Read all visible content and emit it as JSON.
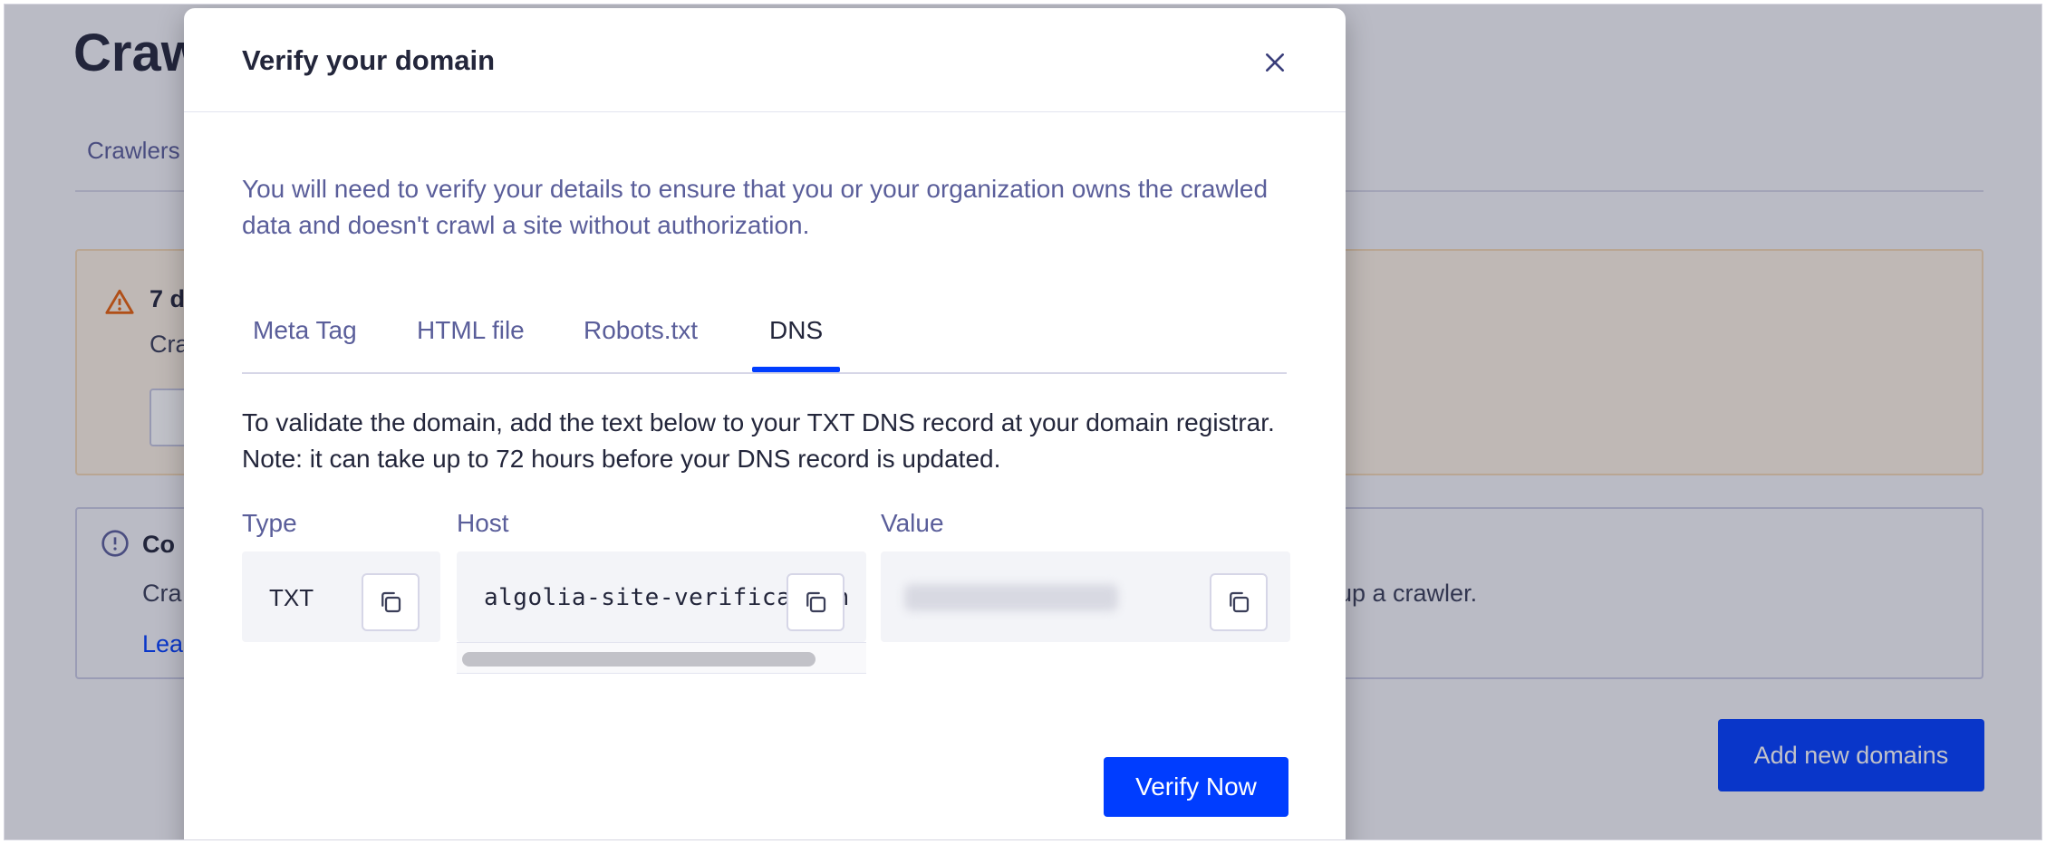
{
  "background": {
    "page_title": "Craw",
    "tab_label": "Crawlers",
    "warning": {
      "title": "7 d",
      "text": "Cra"
    },
    "info": {
      "title": "Co",
      "text": "Cra",
      "text_right": "up a crawler.",
      "link": "Lea"
    },
    "add_domains_label": "Add new domains"
  },
  "modal": {
    "title": "Verify your domain",
    "intro": "You will need to verify your details to ensure that you or your organization owns the crawled data and doesn't crawl a site without authorization.",
    "tabs": [
      "Meta Tag",
      "HTML file",
      "Robots.txt",
      "DNS"
    ],
    "active_tab": "DNS",
    "instructions": "To validate the domain, add the text below to your TXT DNS record at your domain registrar. Note: it can take up to 72 hours before your DNS record is updated.",
    "columns": {
      "type_label": "Type",
      "host_label": "Host",
      "value_label": "Value"
    },
    "record": {
      "type": "TXT",
      "host": "algolia-site-verification"
    },
    "verify_label": "Verify Now"
  },
  "colors": {
    "accent": "#003dff",
    "muted_text": "#5a5e9a",
    "dark_text": "#23263b"
  },
  "icons": [
    "close-icon",
    "copy-icon",
    "warning-icon",
    "info-icon"
  ]
}
